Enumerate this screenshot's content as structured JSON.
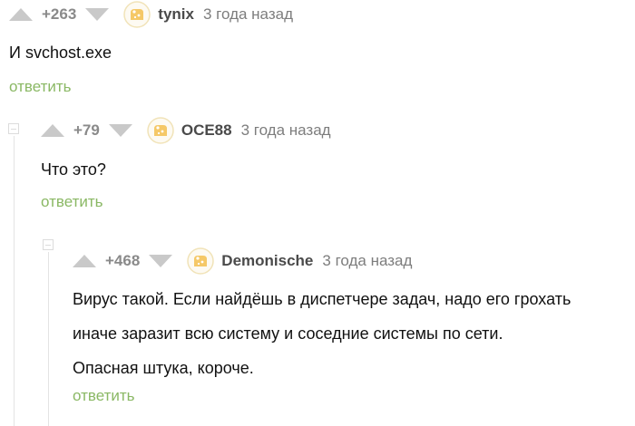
{
  "comments": [
    {
      "rating": "+263",
      "username": "tynix",
      "time": "3 года назад",
      "text": "И svchost.exe",
      "reply": "ответить"
    },
    {
      "rating": "+79",
      "username": "OCE88",
      "time": "3 года назад",
      "text": "Что это?",
      "reply": "ответить"
    },
    {
      "rating": "+468",
      "username": "Demonische",
      "time": "3 года назад",
      "lines": [
        "Вирус такой. Если найдёшь в диспетчере задач, надо его грохать",
        "иначе заразит всю систему и соседние системы по сети.",
        "Опасная штука, короче."
      ],
      "reply": "ответить"
    }
  ],
  "icons": {
    "vote_up": "triangle-up-icon",
    "vote_down": "triangle-down-icon",
    "avatar": "default-avatar-icon",
    "collapse": "collapse-minus-icon"
  },
  "colors": {
    "reply_link": "#8ab864",
    "rating": "#8a8a8a",
    "vote_arrows": "#c9c9c9",
    "username": "#4a4a4a",
    "time": "#7d7d7d"
  }
}
